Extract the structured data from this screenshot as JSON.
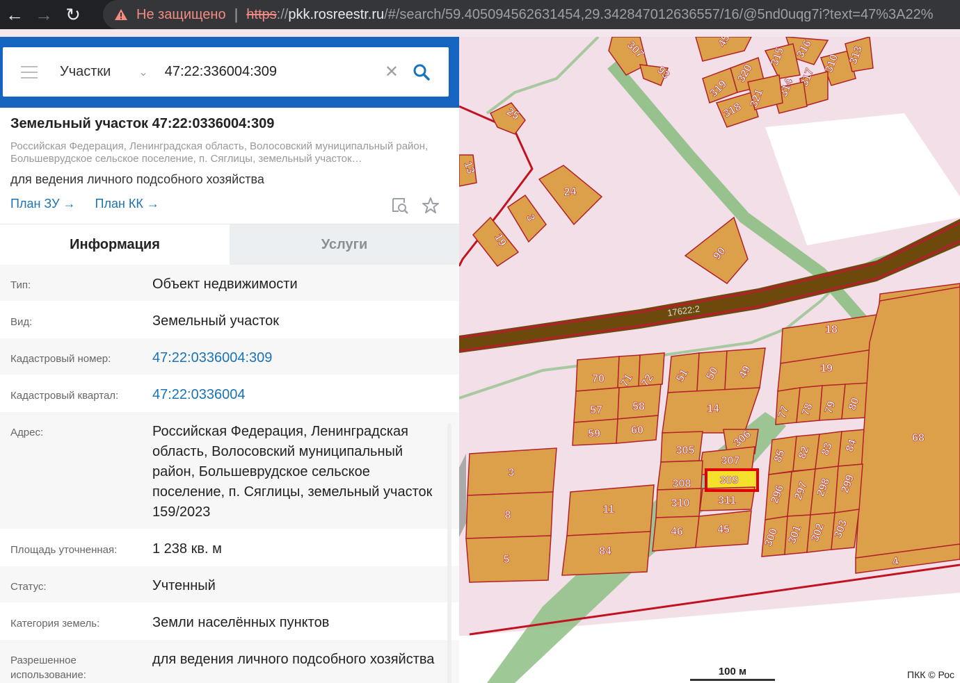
{
  "browser": {
    "back_icon": "←",
    "forward_icon": "→",
    "reload_icon": "↻",
    "security_label": "Не защищено",
    "separator": "|",
    "url_scheme": "https",
    "url_sep": "://",
    "url_host": "pkk.rosreestr.ru",
    "url_rest": "/#/search/59.405094562631454,29.342847012636557/16/@5nd0uqg7i?text=47%3A22%"
  },
  "search": {
    "category": "Участки",
    "query": "47:22:336004:309"
  },
  "card": {
    "title": "Земельный участок 47:22:0336004:309",
    "address": "Российская Федерация, Ленинградская область, Волосовский муниципальный район, Большеврудское сельское поселение, п. Сяглицы, земельный участок…",
    "use": "для ведения личного подсобного хозяйства",
    "link_plan_zu": "План ЗУ →",
    "link_plan_kk": "План КК →"
  },
  "tabs": {
    "info": "Информация",
    "services": "Услуги"
  },
  "attributes": [
    {
      "label": "Тип:",
      "value": "Объект недвижимости"
    },
    {
      "label": "Вид:",
      "value": "Земельный участок"
    },
    {
      "label": "Кадастровый номер:",
      "value": "47:22:0336004:309"
    },
    {
      "label": "Кадастровый квартал:",
      "value": "47:22:0336004"
    },
    {
      "label": "Адрес:",
      "value": "Российская Федерация, Ленинградская область, Волосовский муниципальный район, Большеврудское сельское поселение, п. Сяглицы, земельный участок 159/2023"
    },
    {
      "label": "Площадь уточненная:",
      "value": "1 238 кв. м"
    },
    {
      "label": "Статус:",
      "value": "Учтенный"
    },
    {
      "label": "Категория земель:",
      "value": "Земли населённых пунктов"
    },
    {
      "label": "Разрешенное использование:",
      "value": "для ведения личного подсобного хозяйства"
    }
  ],
  "map": {
    "road_label": "17622:2",
    "selected_parcel": "309",
    "scale_label": "100 м",
    "copyright": "ПКК © Рос",
    "parcel_labels": [
      "307",
      "93",
      "45",
      "316",
      "315",
      "310",
      "313",
      "319",
      "320",
      "317",
      "314",
      "318",
      "321",
      "25",
      "13",
      "24",
      "3",
      "19",
      "90",
      "24",
      "18",
      "19",
      "70",
      "71",
      "72",
      "51",
      "50",
      "49",
      "57",
      "58",
      "14",
      "59",
      "60",
      "77",
      "78",
      "79",
      "80",
      "305",
      "306",
      "307",
      "85",
      "82",
      "83",
      "84",
      "68",
      "3",
      "308",
      "309",
      "311",
      "296",
      "297",
      "298",
      "299",
      "8",
      "11",
      "310",
      "46",
      "45",
      "300",
      "301",
      "302",
      "303",
      "5",
      "84",
      "4"
    ],
    "colors": {
      "parcel_fill": "#dda04a",
      "parcel_border": "#b2202a",
      "zone_fill": "#f3dfe7",
      "road_fill": "#6b4a0c",
      "road_green": "#8dbf84",
      "selected_fill": "#f5e12c",
      "selection_frame": "#e00000"
    }
  }
}
